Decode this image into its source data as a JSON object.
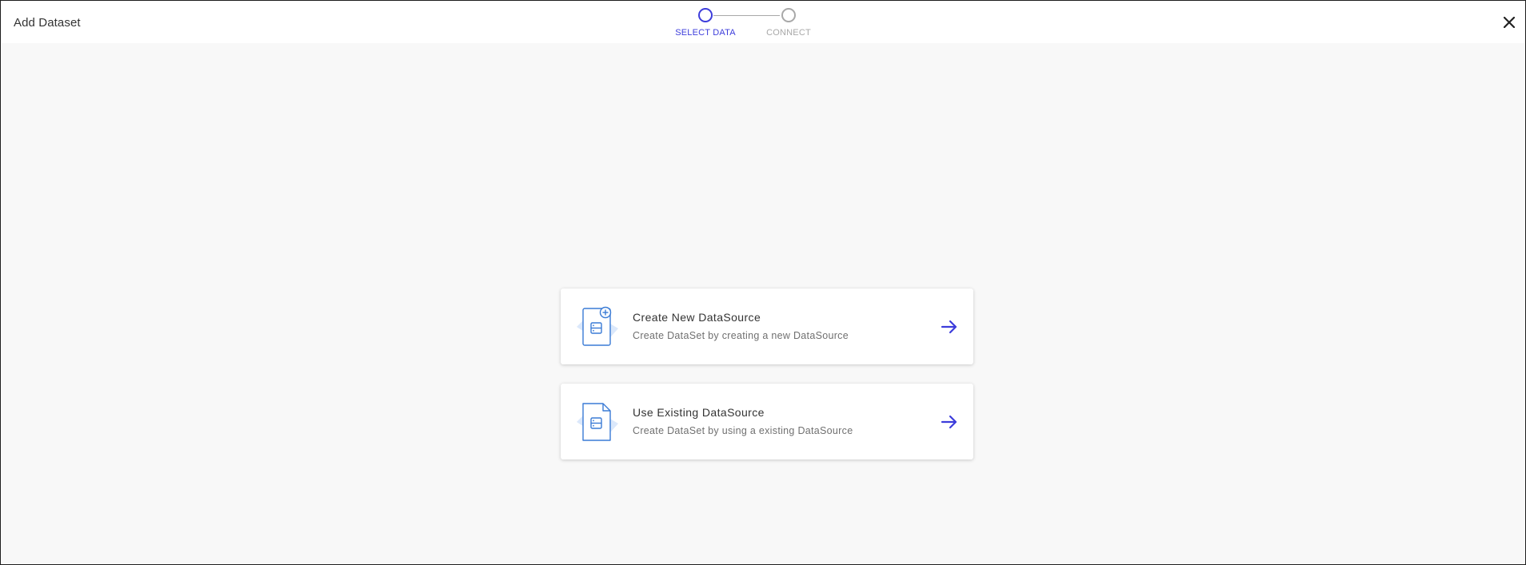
{
  "header": {
    "title": "Add Dataset",
    "close_icon": "close-icon"
  },
  "stepper": {
    "steps": [
      {
        "label": "SELECT DATA",
        "state": "active"
      },
      {
        "label": "CONNECT",
        "state": "inactive"
      }
    ]
  },
  "options": [
    {
      "title": "Create New DataSource",
      "description": "Create DataSet by creating a new DataSource",
      "icon": "new-datasource-icon",
      "action_icon": "arrow-right-icon"
    },
    {
      "title": "Use Existing DataSource",
      "description": "Create DataSet by using a existing DataSource",
      "icon": "existing-datasource-icon",
      "action_icon": "arrow-right-icon"
    }
  ],
  "colors": {
    "accent": "#3d3ddb",
    "inactive": "#a8a8a8",
    "icon_blue": "#3a7bd5",
    "icon_backdrop": "#dbe8fb",
    "background": "#f8f8f8"
  }
}
